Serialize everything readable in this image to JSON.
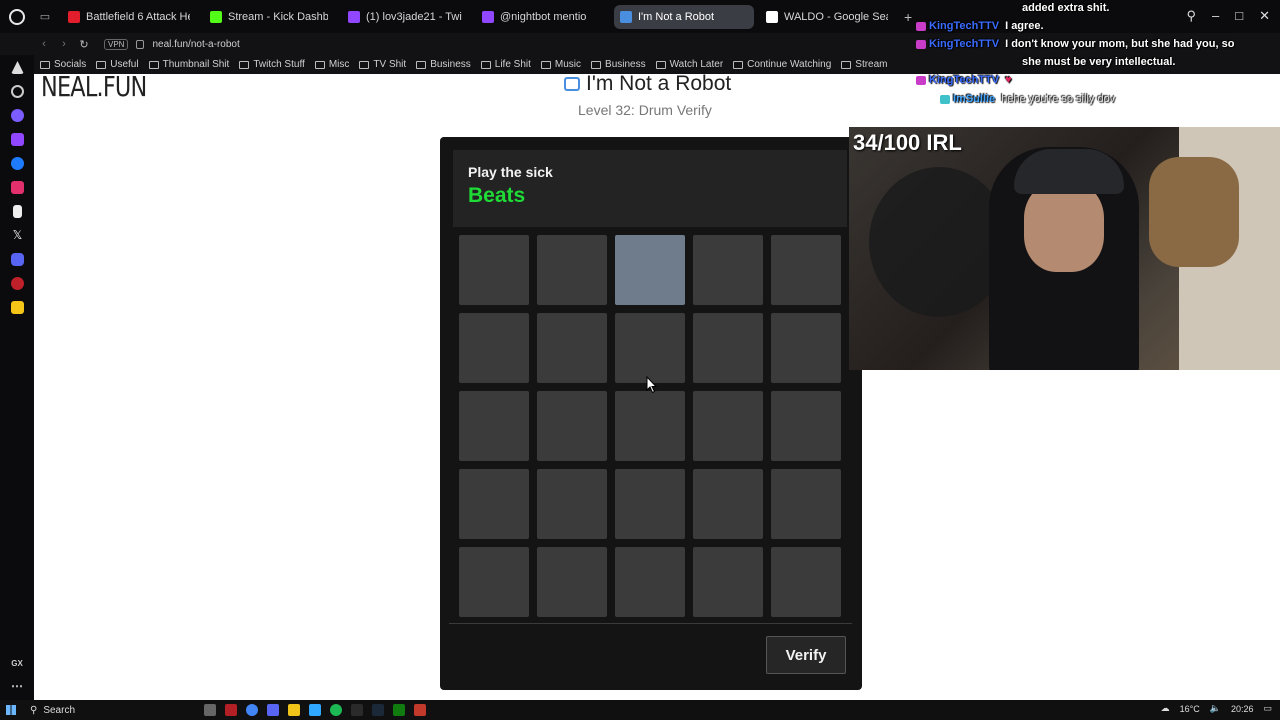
{
  "tabs": [
    {
      "label": "Battlefield 6 Attack Helico",
      "color": "#e21d2c"
    },
    {
      "label": "Stream - Kick Dashbo",
      "color": "#53fc18"
    },
    {
      "label": "(1) lov3jade21 - Twitch",
      "color": "#9146ff"
    },
    {
      "label": "@nightbot mentio",
      "color": "#9146ff"
    },
    {
      "label": "I'm Not a Robot",
      "color": "#4a8ee0",
      "active": true
    },
    {
      "label": "WALDO - Google Search",
      "color": "#ffffff"
    }
  ],
  "address": {
    "vpn": "VPN",
    "url": "neal.fun/not-a-robot"
  },
  "bookmarks": [
    "Socials",
    "Useful",
    "Thumbnail Shit",
    "Twitch Stuff",
    "Misc",
    "TV Shit",
    "Business",
    "Life Shit",
    "Music",
    "Business",
    "Watch Later",
    "Continue Watching",
    "Stream"
  ],
  "sidebar_label": "GX",
  "page": {
    "logo": "NEAL.FUN",
    "title": "I'm Not a Robot",
    "level": "Level 32: Drum Verify"
  },
  "captcha": {
    "prompt": "Play the sick",
    "word": "Beats",
    "word_color": "#1edb36",
    "grid_rows": 5,
    "grid_cols": 5,
    "lit_pad": [
      0,
      2
    ],
    "verify_label": "Verify"
  },
  "webcam": {
    "overlay_text": "34/100 IRL"
  },
  "chat": [
    {
      "name": "",
      "text": "added extra shit."
    },
    {
      "name": "KingTechTTV",
      "text": "I agree."
    },
    {
      "name": "KingTechTTV",
      "text": "I don't know your mom, but she had you, so"
    },
    {
      "name": "",
      "text": "she must be very intellectual."
    },
    {
      "name": "KingTechTTV",
      "text": "♥"
    },
    {
      "name": "ImSullie",
      "text": "hehe you're so silly dov"
    }
  ],
  "taskbar": {
    "search_label": "Search",
    "temperature": "16°C",
    "time": "20:26"
  }
}
